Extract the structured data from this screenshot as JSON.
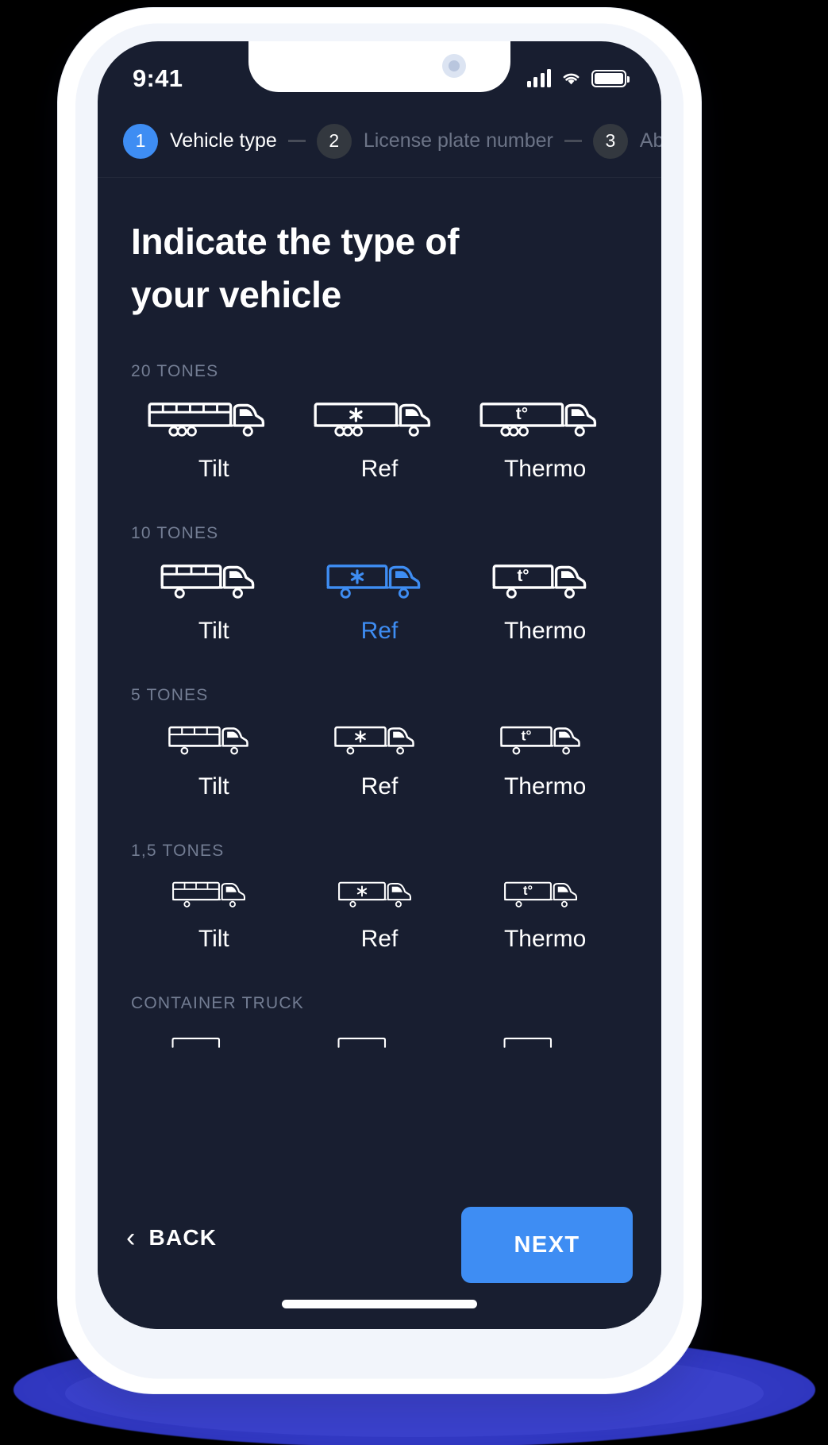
{
  "status_bar": {
    "time": "9:41",
    "icons": [
      "signal-icon",
      "wifi-icon",
      "battery-icon"
    ]
  },
  "stepper": {
    "steps": [
      {
        "number": "1",
        "label": "Vehicle type",
        "active": true
      },
      {
        "number": "2",
        "label": "License plate number",
        "active": false
      },
      {
        "number": "3",
        "label": "Ab",
        "active": false
      }
    ]
  },
  "main": {
    "title": "Indicate the type of your vehicle",
    "groups": [
      {
        "label": "20 TONES",
        "size": "semi",
        "options": [
          {
            "label": "Tilt",
            "kind": "tilt",
            "selected": false
          },
          {
            "label": "Ref",
            "kind": "ref",
            "selected": false
          },
          {
            "label": "Thermo",
            "kind": "thermo",
            "selected": false
          }
        ]
      },
      {
        "label": "10 TONES",
        "size": "large",
        "options": [
          {
            "label": "Tilt",
            "kind": "tilt",
            "selected": false
          },
          {
            "label": "Ref",
            "kind": "ref",
            "selected": true
          },
          {
            "label": "Thermo",
            "kind": "thermo",
            "selected": false
          }
        ]
      },
      {
        "label": "5 TONES",
        "size": "medium",
        "options": [
          {
            "label": "Tilt",
            "kind": "tilt",
            "selected": false
          },
          {
            "label": "Ref",
            "kind": "ref",
            "selected": false
          },
          {
            "label": "Thermo",
            "kind": "thermo",
            "selected": false
          }
        ]
      },
      {
        "label": "1,5 TONES",
        "size": "small",
        "options": [
          {
            "label": "Tilt",
            "kind": "tilt",
            "selected": false
          },
          {
            "label": "Ref",
            "kind": "ref",
            "selected": false
          },
          {
            "label": "Thermo",
            "kind": "thermo",
            "selected": false
          }
        ]
      },
      {
        "label": "CONTAINER TRUCK",
        "size": "clipped",
        "options": [
          {
            "label": "",
            "kind": "container",
            "selected": false
          },
          {
            "label": "",
            "kind": "container",
            "selected": false
          },
          {
            "label": "",
            "kind": "container",
            "selected": false
          }
        ]
      }
    ],
    "thermo_glyph": "t°",
    "ref_glyph": "✳"
  },
  "footer": {
    "back_label": "BACK",
    "back_icon": "chevron-left-icon",
    "next_label": "NEXT"
  },
  "colors": {
    "accent": "#3E8DF3",
    "screen_bg": "#181E30",
    "muted_text": "#737D93",
    "step_inactive": "#33383F",
    "shadow": "#3B41CB"
  }
}
